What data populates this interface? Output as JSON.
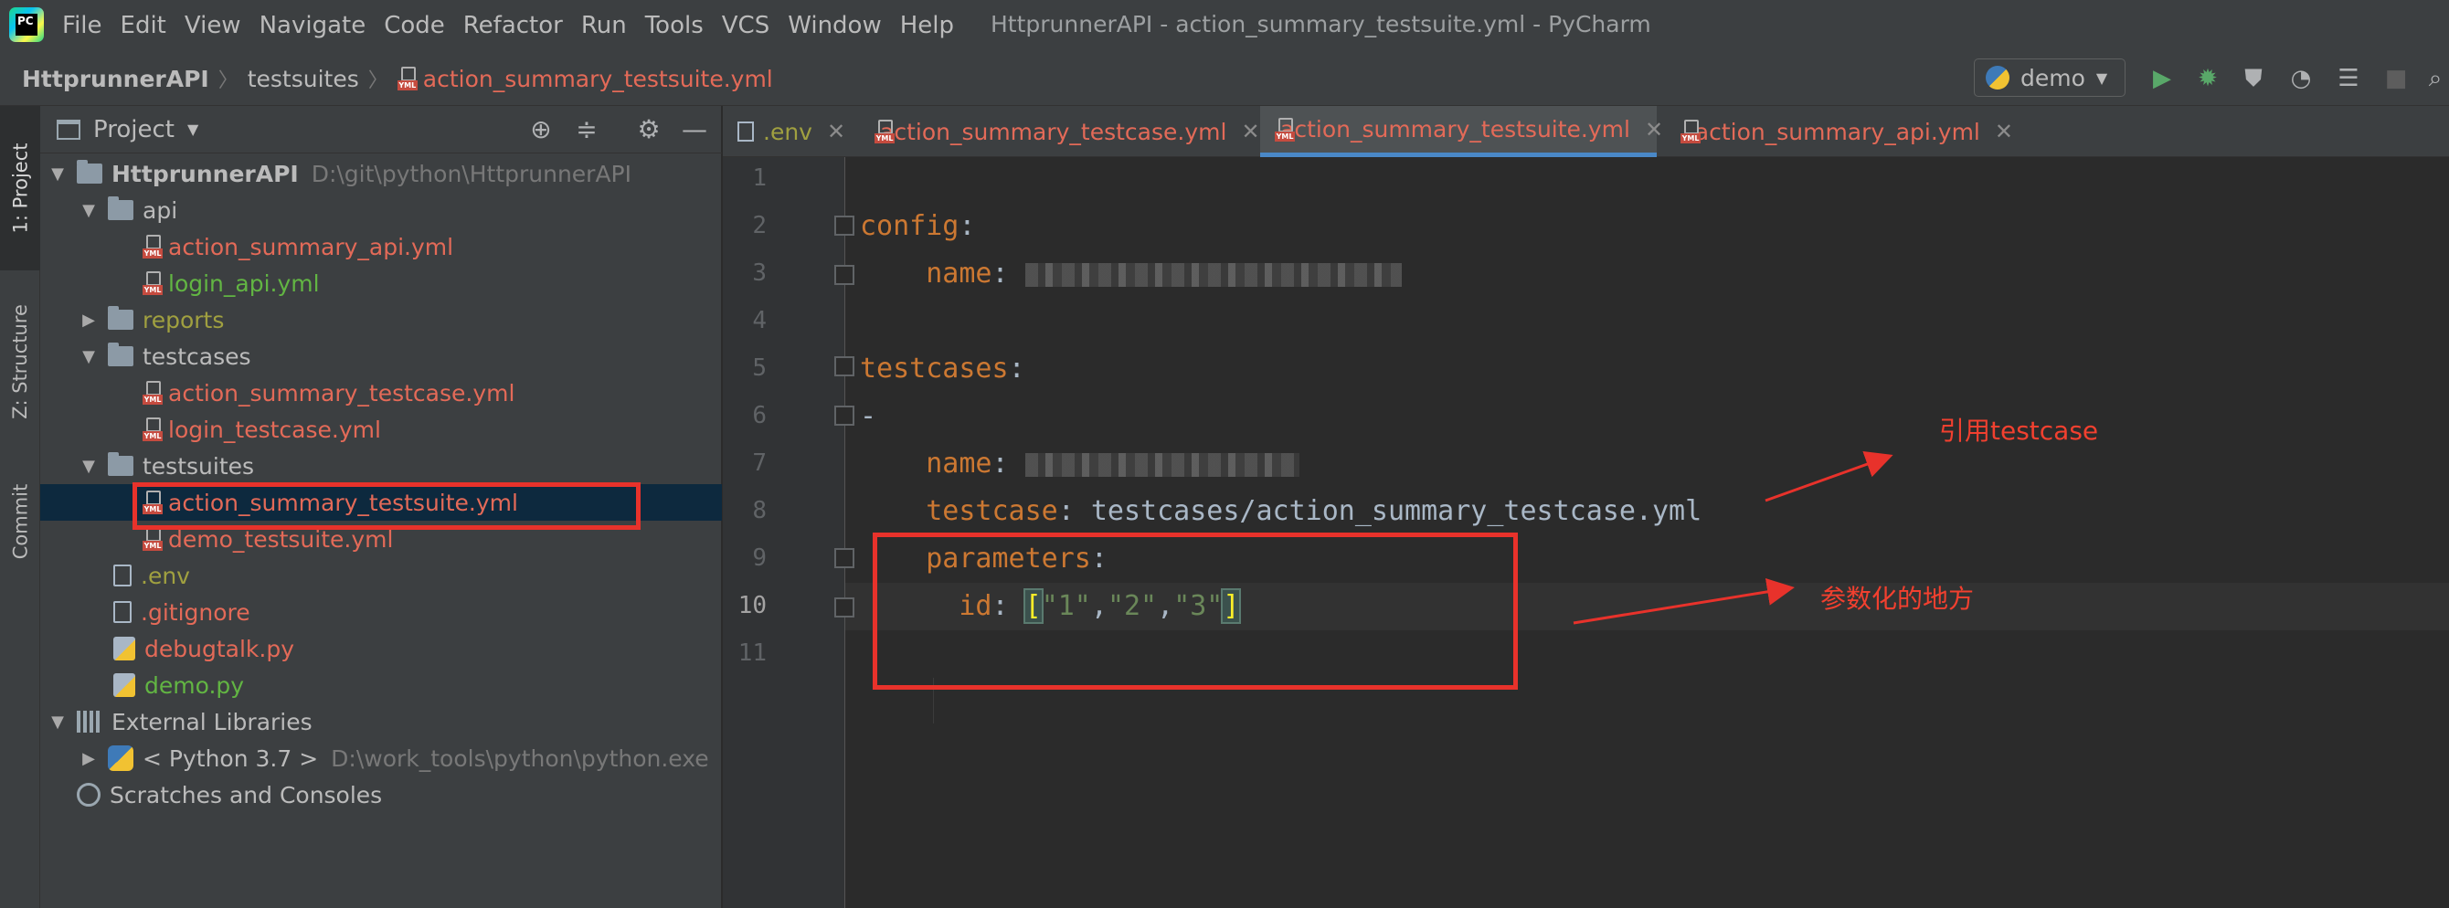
{
  "window": {
    "title": "HttprunnerAPI - action_summary_testsuite.yml - PyCharm",
    "logo_text": "PC"
  },
  "menu": [
    "File",
    "Edit",
    "View",
    "Navigate",
    "Code",
    "Refactor",
    "Run",
    "Tools",
    "VCS",
    "Window",
    "Help"
  ],
  "breadcrumb": {
    "project": "HttprunnerAPI",
    "folder": "testsuites",
    "file": "action_summary_testsuite.yml"
  },
  "run_config": {
    "name": "demo"
  },
  "left_strip": [
    "1: Project",
    "Z: Structure",
    "Commit"
  ],
  "project_panel": {
    "title": "Project",
    "tree": {
      "root_name": "HttprunnerAPI",
      "root_path": "D:\\git\\python\\HttprunnerAPI",
      "api": "api",
      "api_files": [
        "action_summary_api.yml",
        "login_api.yml"
      ],
      "reports": "reports",
      "testcases": "testcases",
      "testcase_files": [
        "action_summary_testcase.yml",
        "login_testcase.yml"
      ],
      "testsuites": "testsuites",
      "testsuite_files": [
        "action_summary_testsuite.yml",
        "demo_testsuite.yml"
      ],
      "root_files": [
        ".env",
        ".gitignore",
        "debugtalk.py",
        "demo.py"
      ],
      "external_libraries": "External Libraries",
      "python_name": "< Python 3.7 >",
      "python_path": "D:\\work_tools\\python\\python.exe",
      "scratches": "Scratches and Consoles"
    }
  },
  "editor_tabs": [
    ".env",
    "action_summary_testcase.yml",
    "action_summary_testsuite.yml",
    "action_summary_api.yml"
  ],
  "editor": {
    "line_numbers": [
      "1",
      "2",
      "3",
      "4",
      "5",
      "6",
      "7",
      "8",
      "9",
      "10",
      "11"
    ],
    "code": {
      "config_key": "config",
      "name_key": "name",
      "testcases_key": "testcases",
      "dash": "-",
      "testcase_key": "testcase",
      "testcase_value": "testcases/action_summary_testcase.yml",
      "parameters_key": "parameters",
      "id_key": "id",
      "id_values": [
        "\"1\"",
        "\"2\"",
        "\"3\""
      ]
    }
  },
  "annotations": {
    "testcase_ref": "引用testcase",
    "param_place": "参数化的地方"
  },
  "colors": {
    "annotation_red": "#e8322b",
    "yaml_key": "#cc7832",
    "yaml_string": "#6a8759",
    "selection": "#0d293e"
  }
}
